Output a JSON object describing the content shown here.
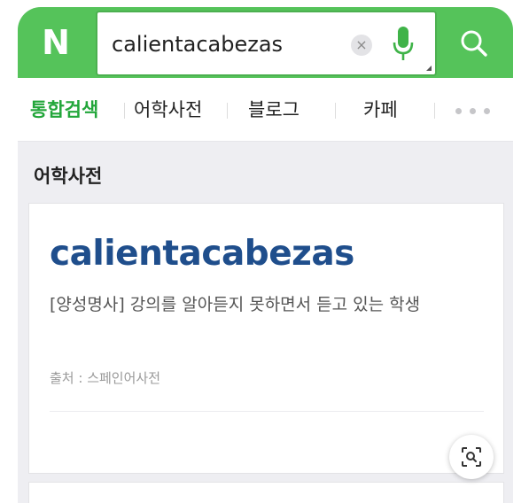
{
  "colors": {
    "brand_green": "#55c35a",
    "active_tab": "#22a63a",
    "headword_blue": "#1f4e8c"
  },
  "logo": {
    "text": "N"
  },
  "search": {
    "query": "calientacabezas",
    "clear_icon": "×"
  },
  "tabs": [
    {
      "label": "통합검색",
      "active": true
    },
    {
      "label": "어학사전",
      "active": false
    },
    {
      "label": "블로그",
      "active": false
    },
    {
      "label": "카페",
      "active": false
    }
  ],
  "section": {
    "title": "어학사전"
  },
  "entry": {
    "headword": "calientacabezas",
    "definition": "[양성명사] 강의를 알아듣지 못하면서 듣고 있는 학생",
    "source": "출처 : 스페인어사전"
  },
  "icons": [
    "naver-logo",
    "clear-icon",
    "microphone-icon",
    "search-icon",
    "more-icon",
    "lens-search-icon"
  ]
}
